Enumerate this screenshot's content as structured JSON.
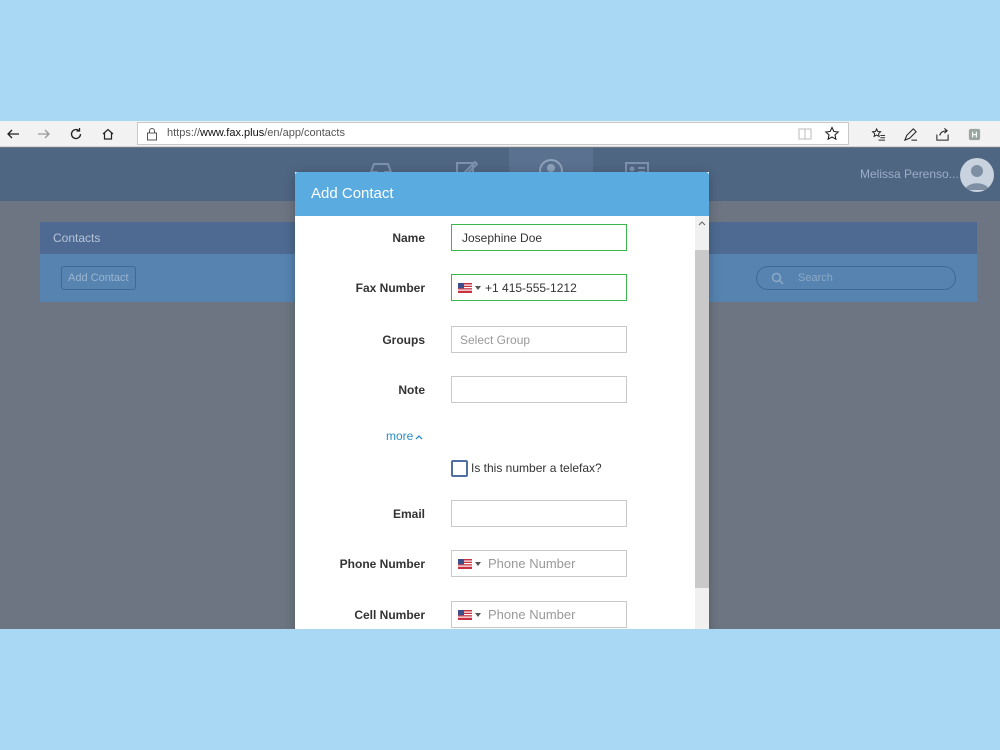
{
  "browser": {
    "url_prefix": "https://",
    "url_host": "www.fax.plus",
    "url_path": "/en/app/contacts"
  },
  "app": {
    "user_name": "Melissa Perenso...",
    "nav_icons": [
      "inbox-icon",
      "compose-icon",
      "contacts-icon",
      "id-card-icon"
    ],
    "active_nav": "contacts-icon"
  },
  "page": {
    "section_title": "Contacts",
    "add_contact_label": "Add Contact",
    "search_placeholder": "Search"
  },
  "modal": {
    "title": "Add Contact",
    "fields": {
      "name": {
        "label": "Name",
        "value": "Josephine Doe"
      },
      "fax": {
        "label": "Fax Number",
        "value": "+1 415-555-1212",
        "country": "US"
      },
      "groups": {
        "label": "Groups",
        "placeholder": "Select Group"
      },
      "note": {
        "label": "Note",
        "value": ""
      },
      "more_label": "more",
      "telefax": {
        "label": "Is this number a telefax?",
        "checked": false
      },
      "email": {
        "label": "Email",
        "value": ""
      },
      "phone": {
        "label": "Phone Number",
        "placeholder": "Phone Number",
        "country": "US"
      },
      "cell": {
        "label": "Cell Number",
        "placeholder": "Phone Number",
        "country": "US"
      }
    }
  },
  "colors": {
    "modal_header": "#5aabe0",
    "valid_border": "#3cb54a",
    "link": "#2b8cc4",
    "backdrop": "#6d7583"
  }
}
